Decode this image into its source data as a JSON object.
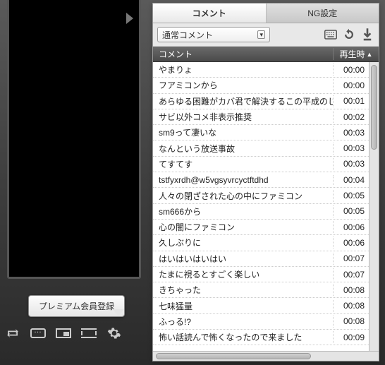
{
  "player": {
    "premium_button_label": "プレミアム会員登録"
  },
  "panel": {
    "tabs": [
      {
        "label": "コメント",
        "active": true
      },
      {
        "label": "NG設定",
        "active": false
      }
    ],
    "filter": {
      "selected": "通常コメント"
    },
    "columns": {
      "comment": "コメント",
      "time": "再生時",
      "sort_indicator": "▲"
    },
    "rows": [
      {
        "comment": "やまりょ",
        "time": "00:00"
      },
      {
        "comment": "フアミコンから",
        "time": "00:00"
      },
      {
        "comment": "あらゆる困難がカバ君で解決するこの平成のじ",
        "time": "00:01"
      },
      {
        "comment": "サビ以外コメ非表示推奨",
        "time": "00:02"
      },
      {
        "comment": "sm9って凄いな",
        "time": "00:03"
      },
      {
        "comment": "なんという放送事故",
        "time": "00:03"
      },
      {
        "comment": "てすてす",
        "time": "00:03"
      },
      {
        "comment": "tstfyxrdh@w5vgsyvrcyctftdhd",
        "time": "00:04"
      },
      {
        "comment": "人々の閉ざされた心の中にファミコン",
        "time": "00:05"
      },
      {
        "comment": "sm666から",
        "time": "00:05"
      },
      {
        "comment": "心の闇にファミコン",
        "time": "00:06"
      },
      {
        "comment": "久しぶりに",
        "time": "00:06"
      },
      {
        "comment": "はいはいはいはい",
        "time": "00:07"
      },
      {
        "comment": "たまに視るとすごく楽しい",
        "time": "00:07"
      },
      {
        "comment": "きちゃった",
        "time": "00:08"
      },
      {
        "comment": "七味猛量",
        "time": "00:08"
      },
      {
        "comment": "ふっる!?",
        "time": "00:08"
      },
      {
        "comment": "怖い話読んで怖くなったので来ました",
        "time": "00:09"
      }
    ]
  }
}
